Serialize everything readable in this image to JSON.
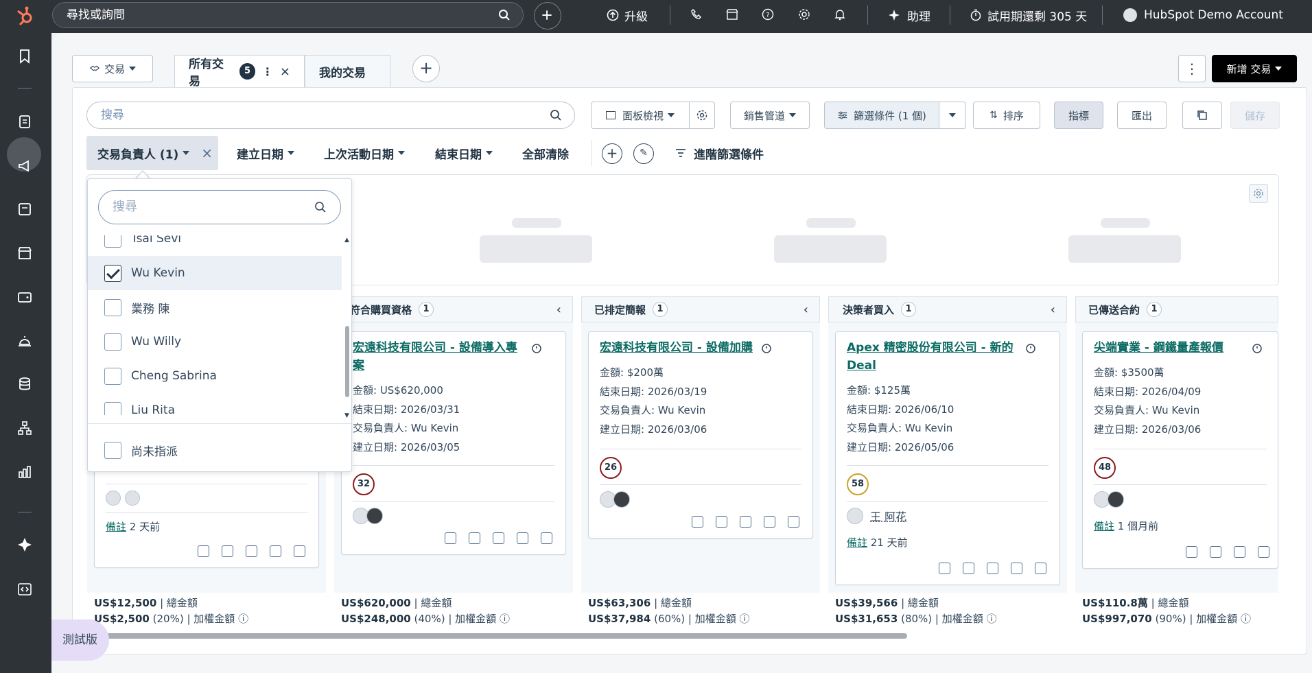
{
  "topbar": {
    "search_placeholder": "尋找或詢問",
    "upgrade": "升級",
    "assistant": "助理",
    "trial": "試用期還剩 305 天",
    "account": "HubSpot Demo Account"
  },
  "toolbar": {
    "object_selector": "交易",
    "tab_all": "所有交易",
    "tab_all_count": "5",
    "tab_mine": "我的交易",
    "new_deal": "新增 交易",
    "search_placeholder": "搜尋",
    "board_view": "面板檢視",
    "pipeline": "銷售管道",
    "filters": "篩選條件 (1 個)",
    "sort": "排序",
    "metrics": "指標",
    "export": "匯出",
    "save": "儲存"
  },
  "filters": {
    "owner": "交易負責人 (1)",
    "create_date": "建立日期",
    "last_activity": "上次活動日期",
    "close_date": "結束日期",
    "clear_all": "全部清除",
    "advanced": "進階篩選條件"
  },
  "owner_dropdown": {
    "search_placeholder": "搜尋",
    "options": [
      {
        "label": "Tsai Sevi",
        "checked": false
      },
      {
        "label": "Wu Kevin",
        "checked": true
      },
      {
        "label": "業務 陳",
        "checked": false
      },
      {
        "label": "Wu Willy",
        "checked": false
      },
      {
        "label": "Cheng Sabrina",
        "checked": false
      },
      {
        "label": "Liu Rita",
        "checked": false
      }
    ],
    "unassigned": "尚未指派"
  },
  "columns": [
    {
      "name": "符合購買資格",
      "count": "1",
      "total": "US$620,000",
      "total_label": "總金額",
      "weighted": "US$248,000",
      "weighted_pct": "(40%)",
      "weighted_label": "加權金額"
    },
    {
      "name": "已排定簡報",
      "count": "1",
      "total": "US$63,306",
      "total_label": "總金額",
      "weighted": "US$37,984",
      "weighted_pct": "(60%)",
      "weighted_label": "加權金額"
    },
    {
      "name": "決策者買入",
      "count": "1",
      "total": "US$39,566",
      "total_label": "總金額",
      "weighted": "US$31,653",
      "weighted_pct": "(80%)",
      "weighted_label": "加權金額"
    },
    {
      "name": "已傳送合約",
      "count": "1",
      "total": "US$110.8萬",
      "total_label": "總金額",
      "weighted": "US$997,070",
      "weighted_pct": "(90%)",
      "weighted_label": "加權金額"
    }
  ],
  "first_column": {
    "total": "US$12,500",
    "total_label": "總金額",
    "weighted": "US$2,500",
    "weighted_pct": "(20%)",
    "weighted_label": "加權金額",
    "note_label": "備註",
    "note_time": "2 天前"
  },
  "cards": [
    {
      "title": "宏遠科技有限公司 - 設備導入專案",
      "amount": "金額: US$620,000",
      "close": "結束日期: 2026/03/31",
      "owner": "交易負責人: Wu Kevin",
      "created": "建立日期: 2026/03/05",
      "score": "32"
    },
    {
      "title": "宏遠科技有限公司 - 設備加購",
      "amount": "金額: $200萬",
      "close": "結束日期: 2026/03/19",
      "owner": "交易負責人: Wu Kevin",
      "created": "建立日期: 2026/03/06",
      "score": "26"
    },
    {
      "title": "Apex 精密股份有限公司 - 新的 Deal",
      "amount": "金額: $125萬",
      "close": "結束日期: 2026/06/10",
      "owner": "交易負責人: Wu Kevin",
      "created": "建立日期: 2026/05/06",
      "score": "58",
      "contact": "王 阿花",
      "note_label": "備註",
      "note_time": "21 天前"
    },
    {
      "title": "尖端實業 - 鋼鐵量產報價",
      "amount": "金額: $3500萬",
      "close": "結束日期: 2026/04/09",
      "owner": "交易負責人: Wu Kevin",
      "created": "建立日期: 2026/03/06",
      "score": "48",
      "note_label": "備註",
      "note_time": "1 個月前"
    }
  ],
  "beta_label": "測試版"
}
